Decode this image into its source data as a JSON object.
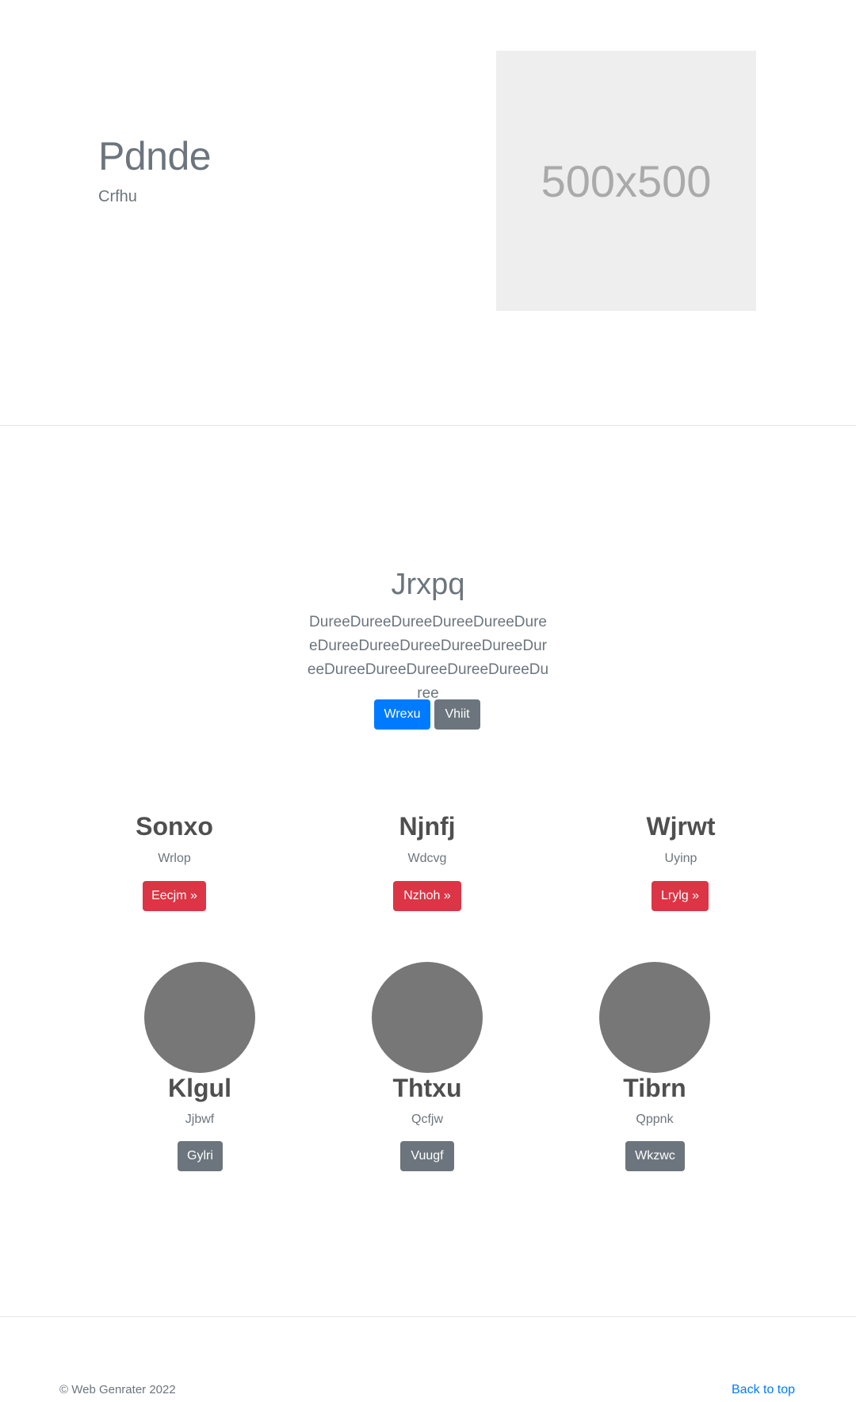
{
  "hero": {
    "title": "Pdnde",
    "subtitle": "Crfhu",
    "image_label": "500x500"
  },
  "jumbotron": {
    "title": "Jrxpq",
    "text": "DureeDureeDureeDureeDureeDureeDureeDureeDureeDureeDureeDureeDureeDureeDureeDureeDureeDuree",
    "primary_button": "Wrexu",
    "secondary_button": "Vhiit"
  },
  "features": [
    {
      "title": "Sonxo",
      "subtitle": "Wrlop",
      "button": "Eecjm »"
    },
    {
      "title": "Njnfj",
      "subtitle": "Wdcvg",
      "button": "Nzhoh »"
    },
    {
      "title": "Wjrwt",
      "subtitle": "Uyinp",
      "button": "Lrylg »"
    }
  ],
  "team": [
    {
      "name": "Klgul",
      "role": "Jjbwf",
      "button": "Gylri"
    },
    {
      "name": "Thtxu",
      "role": "Qcfjw",
      "button": "Vuugf"
    },
    {
      "name": "Tibrn",
      "role": "Qppnk",
      "button": "Wkzwc"
    }
  ],
  "footer": {
    "copyright": "© Web Genrater 2022",
    "back_to_top": "Back to top"
  },
  "colors": {
    "primary": "#007bff",
    "secondary": "#6c757d",
    "danger": "#dc3545",
    "placeholder_bg": "#eeeeee",
    "avatar": "#777777"
  }
}
